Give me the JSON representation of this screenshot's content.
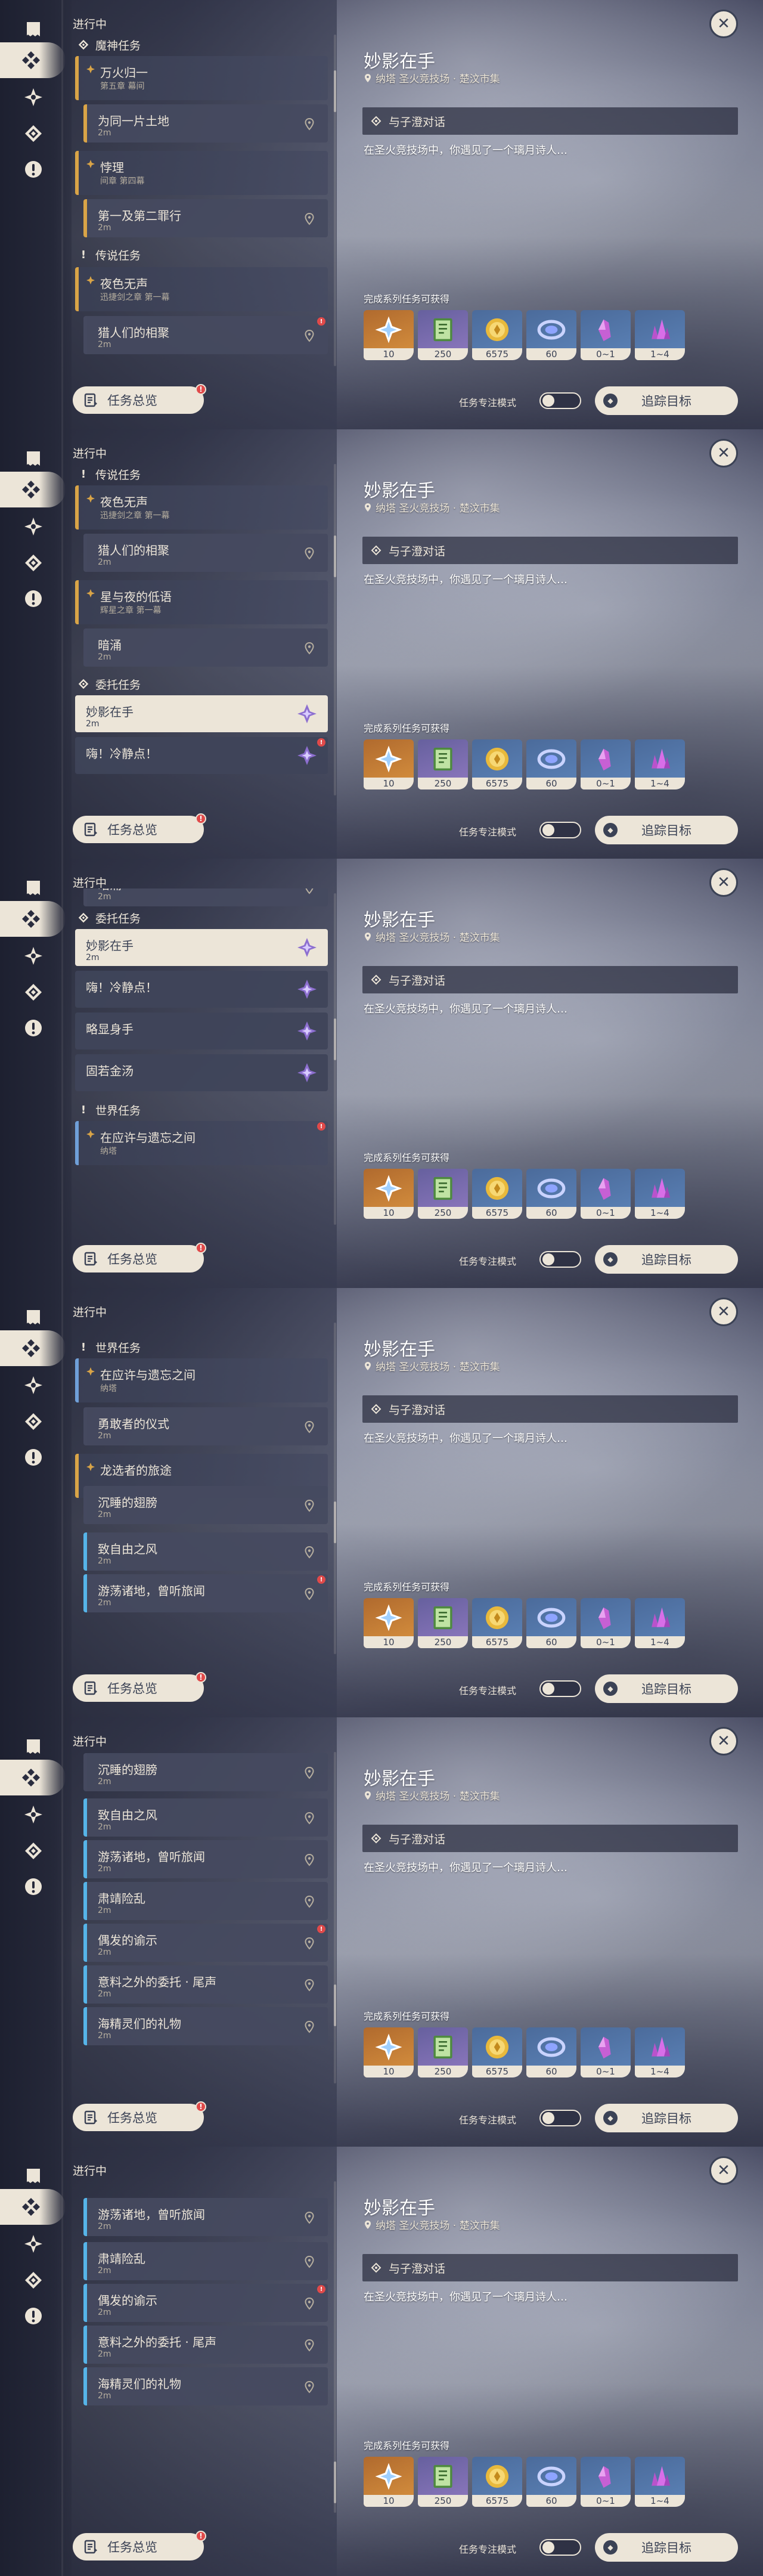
{
  "header": {
    "in_progress": "进行中"
  },
  "rail": {
    "icons": [
      "quest-log-icon",
      "all-quests-icon",
      "archon-quest-icon",
      "world-quest-icon",
      "alert-quest-icon"
    ]
  },
  "detail": {
    "title": "妙影在手",
    "location": "纳塔 圣火竞技场 · 楚汶市集",
    "step": "与子澄对话",
    "description": "在圣火竞技场中，你遇见了一个璃月诗人…",
    "rewards_label": "完成系列任务可获得",
    "rewards": [
      {
        "icon": "adventure-exp-icon",
        "count": "10",
        "tone": "orange"
      },
      {
        "icon": "character-exp-icon",
        "count": "250",
        "tone": "purple"
      },
      {
        "icon": "mora-icon",
        "count": "6575",
        "tone": "blue"
      },
      {
        "icon": "primogem-icon",
        "count": "60",
        "tone": "blue"
      },
      {
        "icon": "crystal-chunk-icon",
        "count": "0~1",
        "tone": "blue"
      },
      {
        "icon": "crystal-cluster-icon",
        "count": "1~4",
        "tone": "blue"
      }
    ]
  },
  "bottom": {
    "overview_label": "任务总览",
    "focus_label": "任务专注模式",
    "track_label": "追踪目标",
    "badge": "!"
  },
  "sections": {
    "archon": "魔神任务",
    "legend": "传说任务",
    "commission": "委托任务",
    "world": "世界任务"
  },
  "quests": {
    "wanhuaguiyi": {
      "title": "万火归一",
      "sub": "第五章 幕间"
    },
    "tongxiang": {
      "title": "为同一片土地",
      "sub": "2m"
    },
    "boli": {
      "title": "悖理",
      "sub": "间章 第四幕"
    },
    "diyi": {
      "title": "第一及第二罪行",
      "sub": "2m"
    },
    "yese": {
      "title": "夜色无声",
      "sub": "迅捷剑之章 第一幕"
    },
    "lieren": {
      "title": "猎人们的相聚",
      "sub": "2m"
    },
    "xingyu": {
      "title": "星与夜的低语",
      "sub": "辉星之章 第一幕"
    },
    "anyong": {
      "title": "暗涌",
      "sub": "2m"
    },
    "miaoying": {
      "title": "妙影在手",
      "sub": "2m"
    },
    "hai": {
      "title": "嗨！冷静点！",
      "sub": ""
    },
    "qiaoxing": {
      "title": "略显身手",
      "sub": ""
    },
    "gurujintang": {
      "title": "固若金汤",
      "sub": ""
    },
    "yingxu": {
      "title": "在应许与遗忘之间",
      "sub": "纳塔"
    },
    "yonggan": {
      "title": "勇敢者的仪式",
      "sub": "2m"
    },
    "longxuan": {
      "title": "龙选者的旅途",
      "sub": ""
    },
    "chenshui": {
      "title": "沉睡的翅膀",
      "sub": "2m"
    },
    "zhiziyou": {
      "title": "致自由之风",
      "sub": "2m"
    },
    "youdang": {
      "title": "游荡诸地，曾听旅闻",
      "sub": "2m"
    },
    "suqing": {
      "title": "肃靖险乱",
      "sub": "2m"
    },
    "ouran": {
      "title": "偶发的谕示",
      "sub": "2m"
    },
    "yiliao": {
      "title": "意料之外的委托 · 尾声",
      "sub": "2m"
    },
    "haijing": {
      "title": "海精灵们的礼物",
      "sub": "2m"
    }
  },
  "colors": {
    "accent": "#d9a447",
    "world": "#56b4e8",
    "cream": "#ece5d8",
    "alert": "#e04a4a"
  }
}
